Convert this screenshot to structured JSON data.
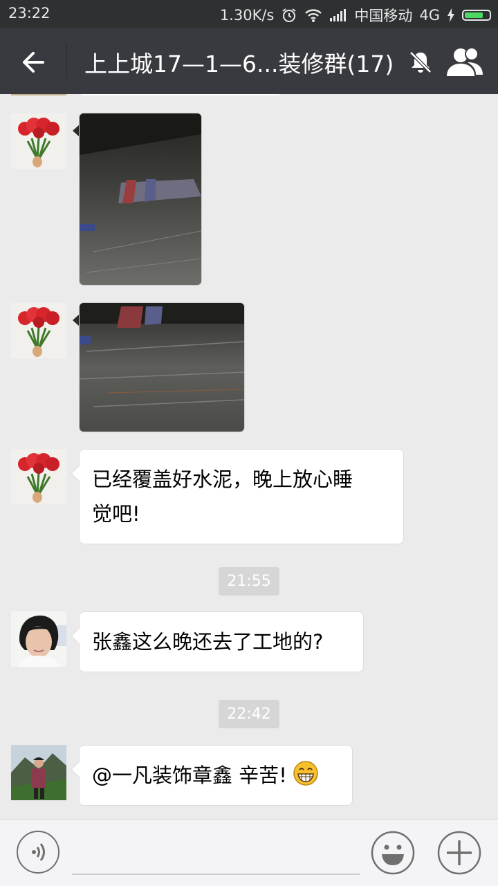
{
  "status_bar": {
    "time": "23:22",
    "net_speed": "1.30K/s",
    "carrier": "中国移动",
    "network": "4G"
  },
  "header": {
    "title": "上上城17—1—6...装修群(17)",
    "icons": [
      "back-arrow-icon",
      "mute-bell-icon",
      "group-members-icon"
    ]
  },
  "messages": [
    {
      "type": "image",
      "sender_avatar": "roses",
      "description": "dark construction floor photo"
    },
    {
      "type": "image",
      "sender_avatar": "roses",
      "description": "cement floor photo"
    },
    {
      "type": "text",
      "sender_avatar": "roses",
      "lines": [
        "已经覆盖好水泥，晚上放心睡",
        "觉吧!"
      ]
    },
    {
      "type": "timestamp",
      "text": "21:55"
    },
    {
      "type": "text",
      "sender_avatar": "woman",
      "lines": [
        "张鑫这么晚还去了工地的?"
      ]
    },
    {
      "type": "timestamp",
      "text": "22:42"
    },
    {
      "type": "text",
      "sender_avatar": "person-outdoor",
      "lines": [
        "@一凡装饰章鑫 辛苦!"
      ],
      "emoji": "grin-emoji"
    }
  ],
  "input_bar": {
    "icons": [
      "voice-icon",
      "emoji-icon",
      "plus-icon"
    ]
  },
  "colors": {
    "topbar": "#393a3f",
    "statusbar": "#2e3132",
    "chat_bg": "#ebebeb",
    "bubble": "#ffffff",
    "timestamp_bg": "#d6d6d6"
  }
}
